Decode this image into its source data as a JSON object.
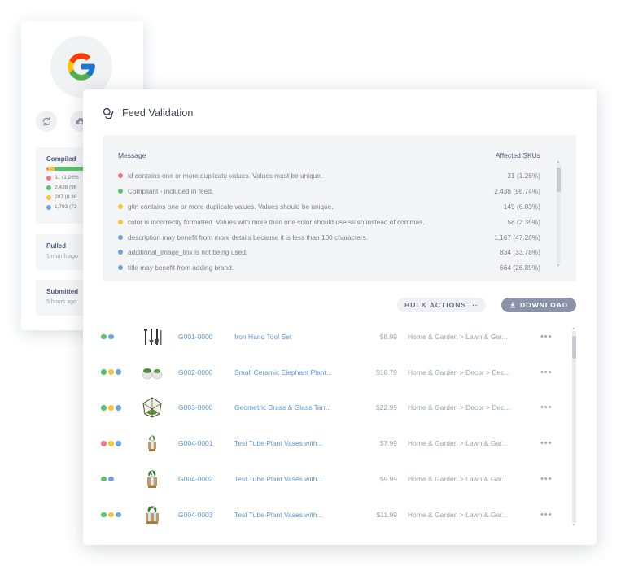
{
  "brand": {
    "logo_icon": "google-g-logo"
  },
  "back_card": {
    "actions": [
      {
        "name": "refresh-button",
        "icon": "refresh-icon"
      },
      {
        "name": "upload-button",
        "icon": "cloud-upload-icon"
      }
    ],
    "compiled": {
      "title": "Compiled",
      "bar_fractions": {
        "red": 0.0126,
        "yellow": 0.06,
        "green": 0.93
      },
      "rows": [
        {
          "status": "error",
          "text": "31 (1.26%"
        },
        {
          "status": "success",
          "text": "2,438 (98"
        },
        {
          "status": "warning",
          "text": "207 (8.38"
        },
        {
          "status": "info",
          "text": "1,793 (72"
        }
      ]
    },
    "pulled": {
      "title": "Pulled",
      "sub": "1 month ago"
    },
    "submitted": {
      "title": "Submitted",
      "sub": "5 hours ago"
    }
  },
  "feed": {
    "title": "Feed Validation",
    "title_icon": "coins-stack-icon",
    "messages_header": {
      "message": "Message",
      "affected": "Affected SKUs"
    },
    "messages": [
      {
        "status": "error",
        "text": "id contains one or more duplicate values. Values must be unique.",
        "value": "31  (1.26%)"
      },
      {
        "status": "success",
        "text": "Compliant - included in feed.",
        "value": "2,438  (98.74%)"
      },
      {
        "status": "warning",
        "text": "gtin contains one or more duplicate values. Values should be unique.",
        "value": "149  (6.03%)"
      },
      {
        "status": "warning",
        "text": "color is incorrectly formatted. Values with more than one color should use slash instead of commas.",
        "value": "58  (2.35%)"
      },
      {
        "status": "info",
        "text": "description may benefit from more details because it is less than 100 characters.",
        "value": "1,167  (47.26%)"
      },
      {
        "status": "info",
        "text": "additional_image_link is not being used.",
        "value": "834  (33.78%)"
      },
      {
        "status": "info",
        "text": "title may benefit from adding brand.",
        "value": "664  (26.89%)"
      }
    ],
    "bulk_actions_label": "BULK ACTIONS ···",
    "download_label": "DOWNLOAD",
    "products": [
      {
        "statuses": [
          "success",
          "info"
        ],
        "image": "hand-tools",
        "sku": "G001-0000",
        "name": "Iron Hand Tool Set",
        "price": "$8.99",
        "category": "Home & Garden > Lawn & Gar..."
      },
      {
        "statuses": [
          "success",
          "warning",
          "info"
        ],
        "image": "ceramic-elephant-planters",
        "sku": "G002-0000",
        "name": "Small Ceramic Elephant Plant...",
        "price": "$18.79",
        "category": "Home & Garden > Decor > Dec..."
      },
      {
        "statuses": [
          "success",
          "warning",
          "info"
        ],
        "image": "geometric-terrarium",
        "sku": "G003-0000",
        "name": "Geometric Brass & Glass Terr...",
        "price": "$22.99",
        "category": "Home & Garden > Decor > Dec..."
      },
      {
        "statuses": [
          "error",
          "warning",
          "info"
        ],
        "image": "test-tube-vase",
        "sku": "G004-0001",
        "name": "Test Tube Plant Vases with...",
        "price": "$7.99",
        "category": "Home & Garden > Lawn & Gar..."
      },
      {
        "statuses": [
          "success",
          "info"
        ],
        "image": "test-tube-vase",
        "sku": "G004-0002",
        "name": "Test Tube Plant Vases with...",
        "price": "$9.99",
        "category": "Home & Garden > Lawn & Gar..."
      },
      {
        "statuses": [
          "success",
          "warning",
          "info"
        ],
        "image": "test-tube-vase",
        "sku": "G004-0003",
        "name": "Test Tube Plant Vases with...",
        "price": "$11.99",
        "category": "Home & Garden > Lawn & Gar..."
      }
    ],
    "row_action_icon": "more-horizontal-icon"
  },
  "colors": {
    "error": "#f0758a",
    "success": "#57c36a",
    "warning": "#f5c542",
    "info": "#6ea4e0",
    "link": "#5f95cf"
  }
}
